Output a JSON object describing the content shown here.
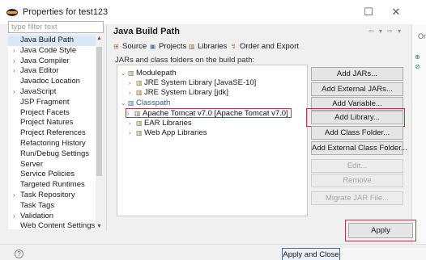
{
  "window": {
    "title": "Properties for test123",
    "minimize": "☐",
    "close": "✕"
  },
  "filter": {
    "placeholder": "type filter text"
  },
  "nav_tree": [
    {
      "label": "Java Build Path",
      "arrow": "",
      "selected": true
    },
    {
      "label": "Java Code Style",
      "arrow": "›"
    },
    {
      "label": "Java Compiler",
      "arrow": "›"
    },
    {
      "label": "Java Editor",
      "arrow": "›"
    },
    {
      "label": "Javadoc Location",
      "arrow": ""
    },
    {
      "label": "JavaScript",
      "arrow": "›"
    },
    {
      "label": "JSP Fragment",
      "arrow": ""
    },
    {
      "label": "Project Facets",
      "arrow": ""
    },
    {
      "label": "Project Natures",
      "arrow": ""
    },
    {
      "label": "Project References",
      "arrow": ""
    },
    {
      "label": "Refactoring History",
      "arrow": ""
    },
    {
      "label": "Run/Debug Settings",
      "arrow": ""
    },
    {
      "label": "Server",
      "arrow": ""
    },
    {
      "label": "Service Policies",
      "arrow": ""
    },
    {
      "label": "Targeted Runtimes",
      "arrow": ""
    },
    {
      "label": "Task Repository",
      "arrow": "›"
    },
    {
      "label": "Task Tags",
      "arrow": ""
    },
    {
      "label": "Validation",
      "arrow": "›"
    },
    {
      "label": "Web Content Settings",
      "arrow": ""
    }
  ],
  "page": {
    "title": "Java Build Path",
    "nav_arrows": "⇦ ▾ ⇨ ▾"
  },
  "tabs": [
    {
      "label": "Source",
      "icon": "⊞"
    },
    {
      "label": "Projects",
      "icon": "▣"
    },
    {
      "label": "Libraries",
      "icon": "▥"
    },
    {
      "label": "Order and Export",
      "icon": "↯"
    }
  ],
  "description": "JARs and class folders on the build path:",
  "entries": {
    "modulepath": "Modulepath",
    "jre_se10": "JRE System Library [JavaSE-10]",
    "jre_jdk": "JRE System Library [jdk]",
    "classpath": "Classpath",
    "tomcat": "Apache Tomcat v7.0 [Apache Tomcat v7.0]",
    "ear": "EAR Libraries",
    "webapp": "Web App Libraries"
  },
  "buttons": {
    "add_jars": "Add JARs...",
    "add_external_jars": "Add External JARs...",
    "add_variable": "Add Variable...",
    "add_library": "Add Library...",
    "add_class_folder": "Add Class Folder...",
    "add_external_class_folder": "Add External Class Folder...",
    "edit": "Edit...",
    "remove": "Remove",
    "migrate_jar": "Migrate JAR File...",
    "apply": "Apply",
    "apply_and_close": "Apply and Close"
  },
  "footer": {
    "help": "?"
  },
  "behind": {
    "text": "Or",
    "g1": "⊕",
    "g2": "⊘"
  }
}
